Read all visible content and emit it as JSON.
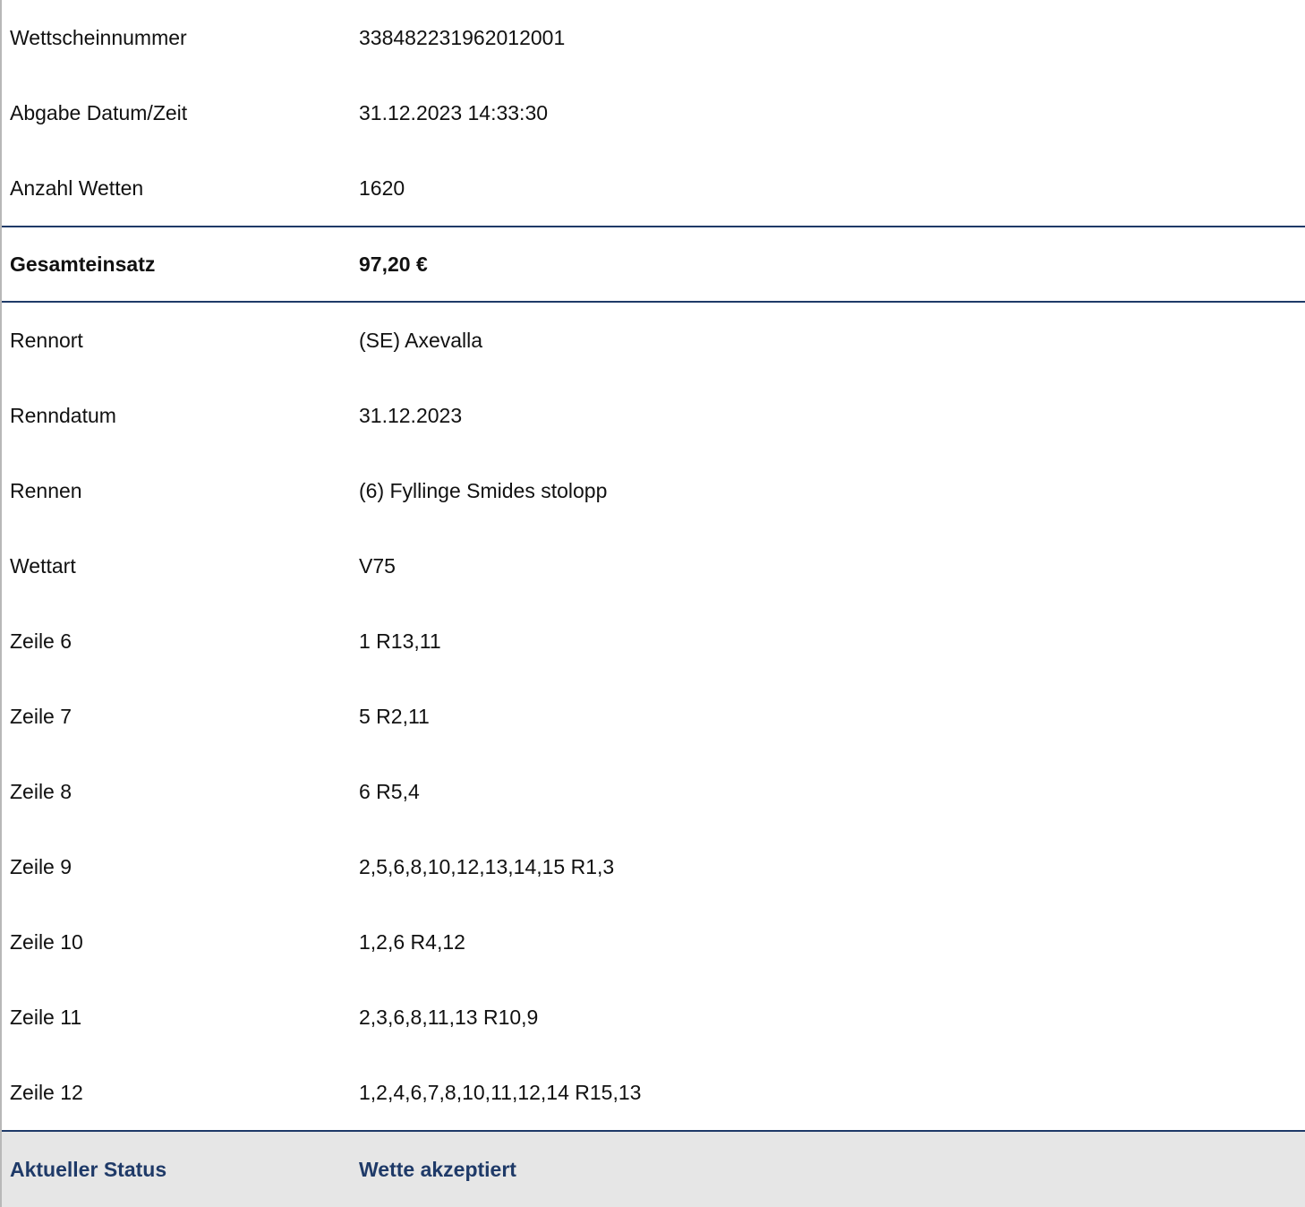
{
  "ticket": {
    "rows_top": [
      {
        "label": "Wettscheinnummer",
        "value": "338482231962012001"
      },
      {
        "label": "Abgabe Datum/Zeit",
        "value": "31.12.2023 14:33:30"
      },
      {
        "label": "Anzahl Wetten",
        "value": "1620"
      }
    ],
    "total": {
      "label": "Gesamteinsatz",
      "value": "97,20 €"
    },
    "rows_details": [
      {
        "label": "Rennort",
        "value": "(SE) Axevalla"
      },
      {
        "label": "Renndatum",
        "value": "31.12.2023"
      },
      {
        "label": "Rennen",
        "value": "(6) Fyllinge Smides stolopp"
      },
      {
        "label": "Wettart",
        "value": "V75"
      },
      {
        "label": "Zeile 6",
        "value": "1 R13,11"
      },
      {
        "label": "Zeile 7",
        "value": "5 R2,11"
      },
      {
        "label": "Zeile 8",
        "value": "6 R5,4"
      },
      {
        "label": "Zeile 9",
        "value": "2,5,6,8,10,12,13,14,15 R1,3"
      },
      {
        "label": "Zeile 10",
        "value": "1,2,6 R4,12"
      },
      {
        "label": "Zeile 11",
        "value": "2,3,6,8,11,13 R10,9"
      },
      {
        "label": "Zeile 12",
        "value": "1,2,4,6,7,8,10,11,12,14 R15,13"
      }
    ],
    "status": {
      "label": "Aktueller Status",
      "value": "Wette akzeptiert"
    }
  },
  "colors": {
    "accent": "#1f3a68",
    "status_bg": "#e6e6e6",
    "frame_left": "#b8b8b8"
  }
}
